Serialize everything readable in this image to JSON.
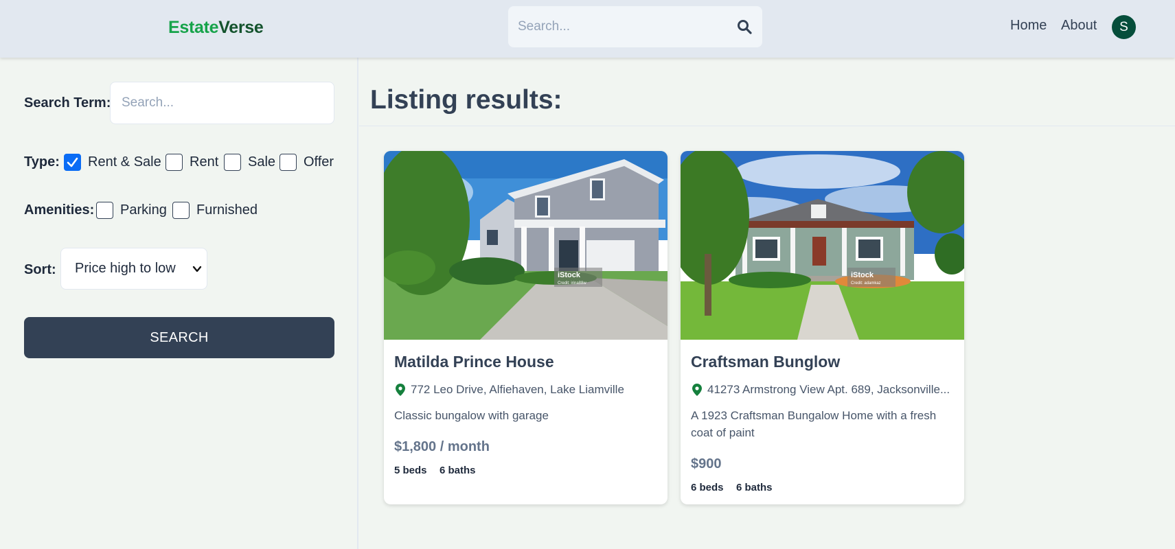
{
  "header": {
    "logo_part1": "Estate",
    "logo_part2": "Verse",
    "search_placeholder": "Search...",
    "nav": {
      "home": "Home",
      "about": "About"
    },
    "avatar_initial": "S"
  },
  "sidebar": {
    "search_term_label": "Search Term:",
    "search_term_placeholder": "Search...",
    "type_label": "Type:",
    "type_options": [
      {
        "label": "Rent & Sale",
        "checked": true
      },
      {
        "label": "Rent",
        "checked": false
      },
      {
        "label": "Sale",
        "checked": false
      },
      {
        "label": "Offer",
        "checked": false
      }
    ],
    "amenities_label": "Amenities:",
    "amenity_options": [
      {
        "label": "Parking",
        "checked": false
      },
      {
        "label": "Furnished",
        "checked": false
      }
    ],
    "sort_label": "Sort:",
    "sort_value": "Price high to low",
    "search_button": "SEARCH"
  },
  "main": {
    "title": "Listing results:",
    "listings": [
      {
        "name": "Matilda Prince House",
        "address": "772 Leo Drive, Alfiehaven, Lake Liamville",
        "description": "Classic bungalow with garage",
        "price": "$1,800 / month",
        "beds": "5 beds",
        "baths": "6 baths",
        "photo_watermark": "iStock",
        "photo_credit": "Credit: irina88w"
      },
      {
        "name": "Craftsman Bunglow",
        "address": "41273 Armstrong View Apt. 689, Jacksonville...",
        "description": "A 1923 Craftsman Bungalow Home with a fresh coat of paint",
        "price": "$900",
        "beds": "6 beds",
        "baths": "6 baths",
        "photo_watermark": "iStock",
        "photo_credit": "Credit: adamkaz"
      }
    ]
  },
  "colors": {
    "header_bg": "#e2e8f0",
    "page_bg": "#f1f5f1",
    "logo_green_light": "#16a34a",
    "logo_green_dark": "#14532d",
    "button_bg": "#334155",
    "checkbox_checked": "#0a6cf5",
    "pin_green": "#15803d",
    "avatar_bg": "#064e3b"
  }
}
